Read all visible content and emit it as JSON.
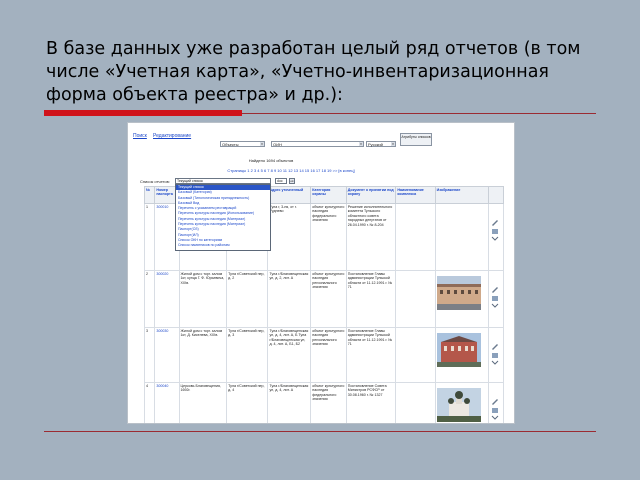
{
  "slide": {
    "heading": "В базе данных уже разработан целый ряд отчетов (в том числе «Учетная карта», «Учетно-инвентаризационная форма объекта реестра» и др.):"
  },
  "toolbar": {
    "search_link": "Поиск",
    "edit_link": "Редактирование",
    "object_select": "Объекты",
    "region_select": "ОИН",
    "lang_select": "Русский",
    "attr_button": "Атрибуты списков"
  },
  "results": {
    "found_text": "Найдено 1694 объектов",
    "pager_text": "Страницы 1 2 3 4 5 6 7 8 9 10 11 12 13 14 15 16 17 18 19 >> [в конец]",
    "reports_label": "Список отчетов:",
    "report_select_value": "Текущий список",
    "format_select_value": "doc",
    "go_button": "ok"
  },
  "reports_dropdown": [
    "Текущий список",
    "Базовый (Категория)",
    "Базовый (Типологическая принадлежность)",
    "Базовый Вид",
    "Перечень с указанием реставраций",
    "Перечень культуры наследия (Использование)",
    "Перечень культуры наследия (Материал)",
    "Перечень культуры наследия (Материал)",
    "Паспорт(ОЗ)",
    "Паспорт(ИЛ)",
    "Список ОКН по категориям",
    "Список памятников по районам"
  ],
  "table": {
    "headers": [
      "№",
      "Номер паспорта",
      "Наименование объекта",
      "Адрес советский",
      "Адрес уточненный",
      "Категория охраны",
      "Документ о принятии под охрану",
      "Наименование комплекса",
      "Изображение",
      ""
    ],
    "rows": [
      {
        "num": "1",
        "id": "300010",
        "name": "",
        "addr": "",
        "addr2": "Тула г, 3-ня, от г. Руднево",
        "cat": "объект культурного наследия федерального значения",
        "doc": "Решение исполнительного комитета Тульского областного совета народных депутатов от 26.04.1990 г. № 8-204",
        "complex": "",
        "has_photo": false
      },
      {
        "num": "2",
        "id": "300020",
        "name": "Жилой дом с торг. залом 1кт, купца Г. Ф. Юрьевича, XIXв.",
        "addr": "Тула г/Советский пер, д. 2",
        "addr2": "Тула г/Благовещенская ул, д. 2, лит. А",
        "cat": "объект культурного наследия регионального значения",
        "doc": "Постановление Главы администрации Тульской области от 11.12.1991 г. № 71",
        "complex": "",
        "has_photo": true
      },
      {
        "num": "3",
        "id": "300030",
        "name": "Жилой дом с торг. залом 1кт, Д. Киселева, XIXв.",
        "addr": "Тула г/Советский пер, д. 3",
        "addr2": "Тула г/Благовещенская ул, д. 4, лит. А, Б Тула г/Благовещенская ул, д. 4, лит. А, Б1, Б2",
        "cat": "объект культурного наследия регионального значения",
        "doc": "Постановление Главы администрации Тульской области от 11.12.1991 г. № 71",
        "complex": "",
        "has_photo": true
      },
      {
        "num": "4",
        "id": "300040",
        "name": "Церковь Благовещения, 1692г.",
        "addr": "Тула г/Советский пер, д. 4",
        "addr2": "Тула г/Благовещенская ул, д. 4, лит. А",
        "cat": "объект культурного наследия федерального значения",
        "doc": "Постановление Совета Министров РСФСР от 30.08.1960 г. № 1327",
        "complex": "",
        "has_photo": true
      }
    ]
  },
  "colors": {
    "background": "#a3b1bf",
    "accent_red": "#d0121a",
    "link_blue": "#1a46c9"
  }
}
